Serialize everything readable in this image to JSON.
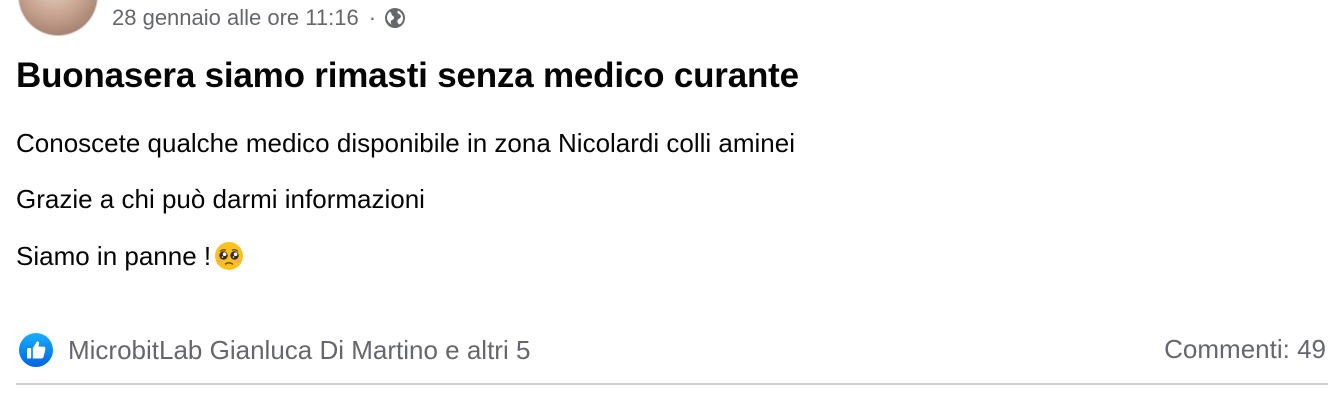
{
  "post": {
    "timestamp": "28 gennaio alle ore 11:16",
    "separator": "·",
    "privacy_icon": "globe-icon",
    "title": "Buonasera siamo rimasti senza medico curante",
    "lines": [
      "Conoscete qualche medico disponibile in zona Nicolardi colli aminei",
      "Grazie a chi può darmi informazioni",
      "Siamo in panne !"
    ],
    "emoji_icon": "pleading-face-emoji"
  },
  "reactions": {
    "icon": "like-icon",
    "text": "MicrobitLab Gianluca Di Martino e altri 5",
    "accent_color": "#1b74e4"
  },
  "comments": {
    "label": "Commenti: 49"
  }
}
